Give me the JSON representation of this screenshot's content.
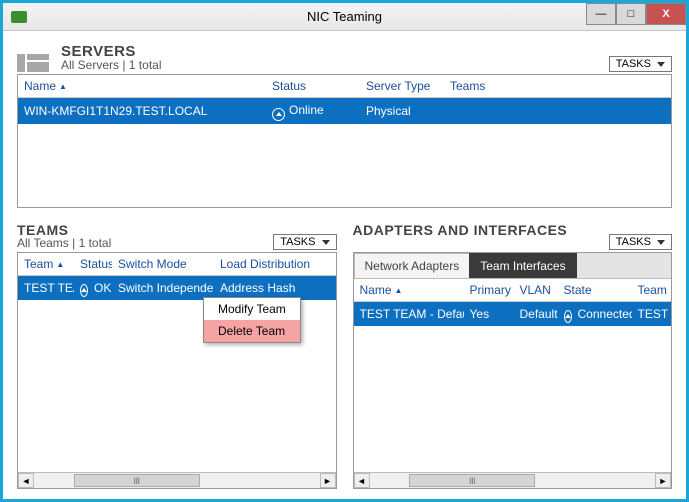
{
  "window": {
    "title": "NIC Teaming"
  },
  "winbuttons": {
    "min": "—",
    "max": "□",
    "close": "X"
  },
  "tasks_label": "TASKS",
  "servers": {
    "title": "SERVERS",
    "subtitle": "All Servers | 1 total",
    "columns": {
      "name": "Name",
      "status": "Status",
      "server_type": "Server Type",
      "teams": "Teams"
    },
    "row": {
      "name": "WIN-KMFGI1T1N29.TEST.LOCAL",
      "status": "Online",
      "server_type": "Physical",
      "teams": ""
    }
  },
  "teams": {
    "title": "TEAMS",
    "subtitle": "All Teams | 1 total",
    "columns": {
      "team": "Team",
      "status": "Status",
      "switch_mode": "Switch Mode",
      "load_dist": "Load Distribution"
    },
    "row": {
      "team": "TEST TEAM",
      "status": "OK",
      "switch_mode": "Switch Independent",
      "load_dist": "Address Hash"
    },
    "context_menu": {
      "modify": "Modify Team",
      "delete": "Delete Team"
    }
  },
  "adapters": {
    "title": "ADAPTERS AND INTERFACES",
    "tabs": {
      "network": "Network Adapters",
      "team": "Team Interfaces"
    },
    "columns": {
      "name": "Name",
      "primary": "Primary",
      "vlan": "VLAN",
      "state": "State",
      "team": "Team"
    },
    "row": {
      "name": "TEST TEAM - Default",
      "primary": "Yes",
      "vlan": "Default",
      "state": "Connected",
      "team": "TEST T"
    }
  },
  "scrollbar": {
    "left": "◄",
    "right": "►",
    "thumb": "lll"
  }
}
